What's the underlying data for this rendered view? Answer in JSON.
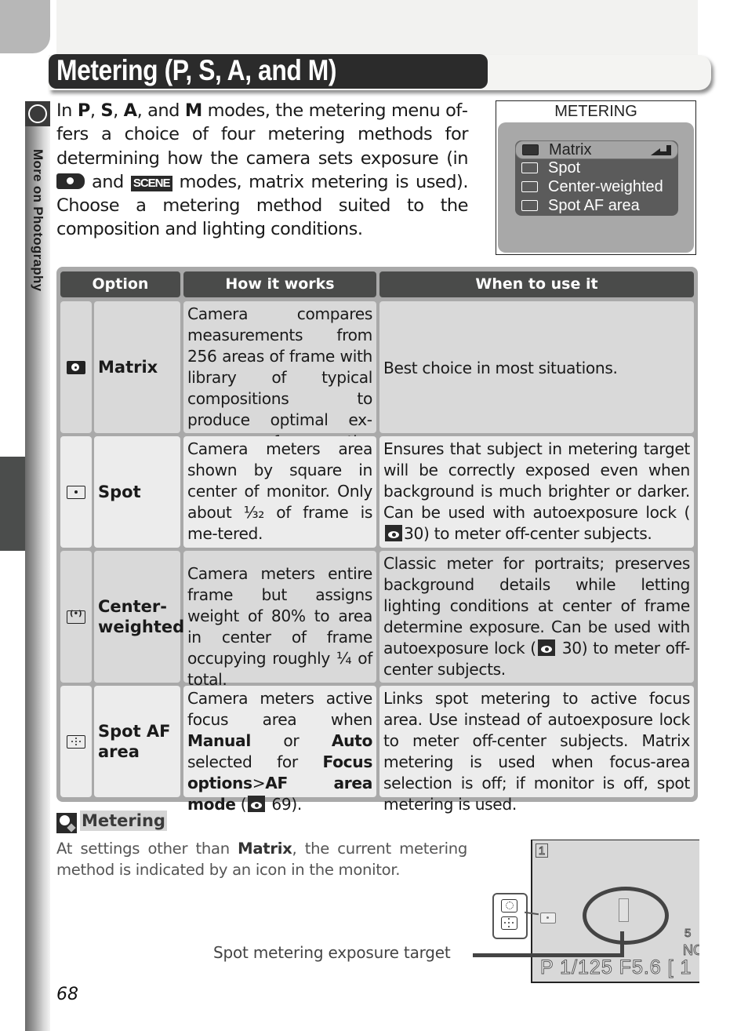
{
  "page": {
    "title": "Metering (P, S, A, and M)",
    "section_label": "More on Photography",
    "page_number": "68"
  },
  "intro": {
    "parts": {
      "t1": "In ",
      "b1": "P",
      "t2": ", ",
      "b2": "S",
      "t3": ", ",
      "b3": "A",
      "t4": ", and ",
      "b4": "M",
      "t5": " modes, the metering menu of­fers a choice of four metering methods for deter­mining how the camera sets exposure (in ",
      "t6": " and ",
      "scene_label": "SCENE",
      "t7": " modes, matrix metering is used).  Choose a metering method suited to the composition and lighting conditions."
    }
  },
  "menu_screenshot": {
    "title": "METERING",
    "items": [
      {
        "label": "Matrix",
        "icon": "matrix-metering-icon",
        "selected": true
      },
      {
        "label": "Spot",
        "icon": "spot-metering-icon",
        "selected": false
      },
      {
        "label": "Center-weighted",
        "icon": "center-weighted-icon",
        "selected": false
      },
      {
        "label": "Spot AF area",
        "icon": "spot-af-area-icon",
        "selected": false
      }
    ]
  },
  "table": {
    "headers": [
      "Option",
      "How it works",
      "When to use it"
    ],
    "rows": [
      {
        "icon": "matrix-metering-icon",
        "option": "Matrix",
        "how": "Camera compares mea­surements from 256 ar­eas of frame with library of typical compositions to produce optimal ex­posure for entire picture.",
        "when": "Best choice in most situations."
      },
      {
        "icon": "spot-metering-icon",
        "option": "Spot",
        "how": "Camera meters area shown by square in center of monitor.  Only about ⅟₃₂ of frame is me­tered.",
        "how_display": "Camera meters area shown by square in center of monitor.  Only about ¹⁄₃₂ of frame is me-tered.",
        "when_a": "Ensures that subject in metering target will be correctly exposed even when background is much brighter or darker. Can be used with autoexposure lock (",
        "when_ref": "30",
        "when_b": ") to meter off-center subjects."
      },
      {
        "icon": "center-weighted-icon",
        "option": "Center-weighted",
        "option_line1": "Center-",
        "option_line2": "weighted",
        "how": "Camera meters entire frame but assigns weight of 80% to area in cen­ter of frame occupying roughly ¼ of total.",
        "when_a": "Classic meter for portraits; preserves background details while letting lighting conditions at center of frame determine exposure.  Can be used with autoex­posure lock (",
        "when_ref": "30",
        "when_b": ") to meter off-center subjects."
      },
      {
        "icon": "spot-af-area-icon",
        "option": "Spot AF area",
        "option_line1": "Spot AF",
        "option_line2": "area",
        "how_parts": {
          "t1": "Camera meters active fo­cus area when ",
          "b1": "Manual",
          "t2": " or ",
          "b2": "Auto",
          "t3": " selected for ",
          "b3": "Fo­cus options",
          "t4": ">",
          "b4": "AF area mode",
          "t5": " (",
          "ref": "69",
          "t6": ")."
        },
        "when": "Links spot metering to active focus area. Use instead of autoexposure lock to me­ter off-center subjects.  Matrix metering is used when focus-area selection is off; if monitor is off, spot metering is used."
      }
    ]
  },
  "tip": {
    "title": "Metering",
    "body_t1": "At settings other than ",
    "body_b1": "Matrix",
    "body_t2": ", the current metering method is indicated by an icon in the monitor."
  },
  "monitor": {
    "frame_indicator": "1",
    "status_line": "P  1/125  F5.6  [  1",
    "right_top": "5",
    "right_mid": "NOR",
    "caption": "Spot metering exposure target"
  }
}
